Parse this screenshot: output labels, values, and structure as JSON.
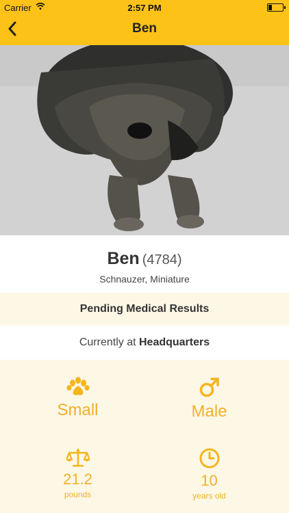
{
  "status_bar": {
    "carrier": "Carrier",
    "time": "2:57 PM"
  },
  "nav": {
    "title": "Ben"
  },
  "pet": {
    "name": "Ben",
    "id": "(4784)",
    "breed": "Schnauzer, Miniature",
    "status": "Pending Medical Results",
    "location_prefix": "Currently at ",
    "location": "Headquarters",
    "size": "Small",
    "gender": "Male",
    "weight": "21.2",
    "weight_unit": "pounds",
    "age": "10",
    "age_unit": "years old"
  },
  "colors": {
    "brand": "#fcc218",
    "accent": "#f0b12a",
    "panel": "#fdf7e6"
  },
  "icons": [
    "back-chevron",
    "paw-icon",
    "male-icon",
    "scale-icon",
    "clock-icon"
  ]
}
